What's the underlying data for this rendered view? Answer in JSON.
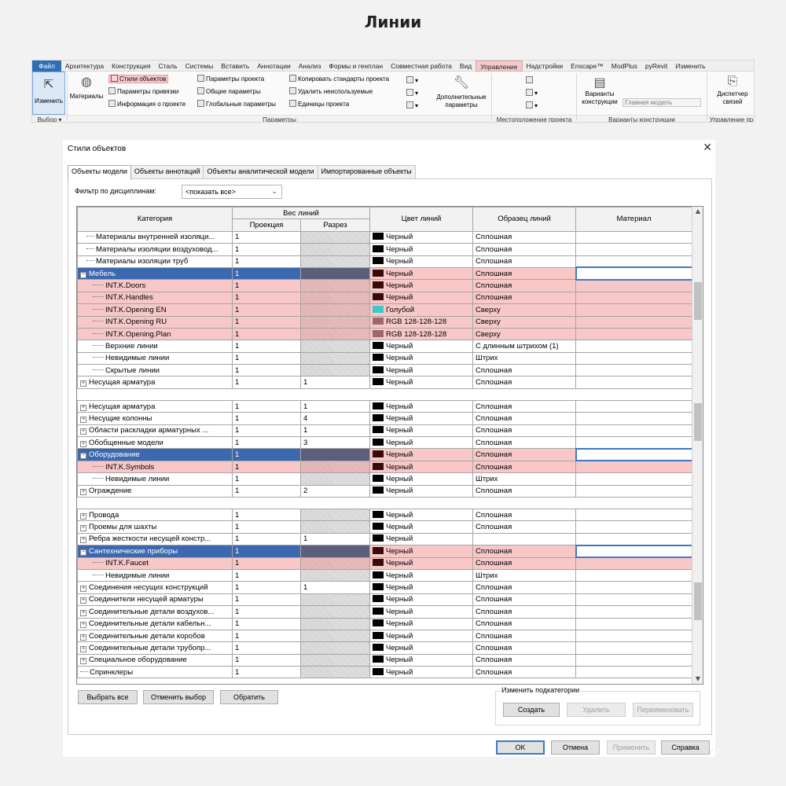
{
  "page": {
    "title": "Линии"
  },
  "ribbon": {
    "tabs": [
      "Файл",
      "Архитектура",
      "Конструкция",
      "Сталь",
      "Системы",
      "Вставить",
      "Аннотации",
      "Анализ",
      "Формы и генплан",
      "Совместная работа",
      "Вид",
      "Управление",
      "Надстройки",
      "Enscape™",
      "ModPlus",
      "pyRevit",
      "Изменить"
    ],
    "active_tab": "Управление",
    "modify_label": "Изменить",
    "materials_label": "Материалы",
    "object_styles": "Стили объектов",
    "snaps": "Параметры привязки",
    "project_info": "Информация о проекте",
    "project_params": "Параметры проекта",
    "shared_params": "Общие параметры",
    "global_params": "Глобальные параметры",
    "transfer_standards": "Копировать стандарты проекта",
    "purge_unused": "Удалить неиспользуемые",
    "project_units": "Единицы проекта",
    "additional_settings": "Дополнительные параметры",
    "design_options": "Варианты конструкции",
    "main_model": "Главная модель",
    "manage_links": "Диспетчер связей",
    "panels": {
      "select": "Выбор ▾",
      "settings": "Параметры",
      "location": "Местоположение проекта",
      "design_options": "Варианты конструкции",
      "manage_project": "Управление пр"
    }
  },
  "dialog": {
    "title": "Стили объектов",
    "tabs": [
      "Объекты модели",
      "Объекты аннотаций",
      "Объекты аналитической модели",
      "Импортированные объекты"
    ],
    "filter_label": "Фильтр по дисциплинам:",
    "filter_value": "<показать все>",
    "columns": {
      "category": "Категория",
      "line_weight": "Вес линий",
      "projection": "Проекция",
      "cut": "Разрез",
      "line_color": "Цвет линий",
      "line_pattern": "Образец линий",
      "material": "Материал"
    },
    "rows_block1": [
      {
        "name": "Материалы внутренней изоляци...",
        "indent": 1,
        "exp": "",
        "proj": "1",
        "cut": "",
        "color": "Черный",
        "swatch": "#000000",
        "pattern": "Сплошная",
        "hl": false,
        "sel": false
      },
      {
        "name": "Материалы изоляции воздуховод...",
        "indent": 1,
        "exp": "",
        "proj": "1",
        "cut": "",
        "color": "Черный",
        "swatch": "#000000",
        "pattern": "Сплошная",
        "hl": false,
        "sel": false
      },
      {
        "name": "Материалы изоляции труб",
        "indent": 1,
        "exp": "",
        "proj": "1",
        "cut": "",
        "color": "Черный",
        "swatch": "#000000",
        "pattern": "Сплошная",
        "hl": false,
        "sel": false
      },
      {
        "name": "Мебель",
        "indent": 0,
        "exp": "−",
        "proj": "1",
        "cut": "",
        "color": "Черный",
        "swatch": "#3a0a0a",
        "pattern": "Сплошная",
        "hl": true,
        "sel": true
      },
      {
        "name": "INT.K.Doors",
        "indent": 2,
        "exp": "",
        "proj": "1",
        "cut": "",
        "color": "Черный",
        "swatch": "#3a0a0a",
        "pattern": "Сплошная",
        "hl": true,
        "sel": false
      },
      {
        "name": "INT.K.Handles",
        "indent": 2,
        "exp": "",
        "proj": "1",
        "cut": "",
        "color": "Черный",
        "swatch": "#3a0a0a",
        "pattern": "Сплошная",
        "hl": true,
        "sel": false
      },
      {
        "name": "INT.K.Opening EN",
        "indent": 2,
        "exp": "",
        "proj": "1",
        "cut": "",
        "color": "Голубой",
        "swatch": "#3fc6c6",
        "pattern": "Сверху",
        "hl": true,
        "sel": false
      },
      {
        "name": "INT.K.Opening RU",
        "indent": 2,
        "exp": "",
        "proj": "1",
        "cut": "",
        "color": "RGB 128-128-128",
        "swatch": "#a06868",
        "pattern": "Сверху",
        "hl": true,
        "sel": false
      },
      {
        "name": "INT.K.Opening.Plan",
        "indent": 2,
        "exp": "",
        "proj": "1",
        "cut": "",
        "color": "RGB 128-128-128",
        "swatch": "#a06868",
        "pattern": "Сверху",
        "hl": true,
        "sel": false
      },
      {
        "name": "Верхние линии",
        "indent": 2,
        "exp": "",
        "proj": "1",
        "cut": "",
        "color": "Черный",
        "swatch": "#000000",
        "pattern": "С длинным штрихом (1)",
        "hl": false,
        "sel": false
      },
      {
        "name": "Невидимые линии",
        "indent": 2,
        "exp": "",
        "proj": "1",
        "cut": "",
        "color": "Черный",
        "swatch": "#000000",
        "pattern": "Штрих",
        "hl": false,
        "sel": false
      },
      {
        "name": "Скрытые линии",
        "indent": 2,
        "exp": "",
        "proj": "1",
        "cut": "",
        "color": "Черный",
        "swatch": "#000000",
        "pattern": "Сплошная",
        "hl": false,
        "sel": false
      },
      {
        "name": "Несущая арматура",
        "indent": 0,
        "exp": "+",
        "proj": "1",
        "cut": "1",
        "color": "Черный",
        "swatch": "#000000",
        "pattern": "Сплошная",
        "hl": false,
        "sel": false
      }
    ],
    "rows_block2": [
      {
        "name": "Несущая арматура",
        "indent": 0,
        "exp": "+",
        "proj": "1",
        "cut": "1",
        "color": "Черный",
        "swatch": "#000000",
        "pattern": "Сплошная",
        "hl": false,
        "sel": false
      },
      {
        "name": "Несущие колонны",
        "indent": 0,
        "exp": "+",
        "proj": "1",
        "cut": "4",
        "color": "Черный",
        "swatch": "#000000",
        "pattern": "Сплошная",
        "hl": false,
        "sel": false
      },
      {
        "name": "Области раскладки арматурных ...",
        "indent": 0,
        "exp": "+",
        "proj": "1",
        "cut": "1",
        "color": "Черный",
        "swatch": "#000000",
        "pattern": "Сплошная",
        "hl": false,
        "sel": false
      },
      {
        "name": "Обобщенные модели",
        "indent": 0,
        "exp": "+",
        "proj": "1",
        "cut": "3",
        "color": "Черный",
        "swatch": "#000000",
        "pattern": "Сплошная",
        "hl": false,
        "sel": false
      },
      {
        "name": "Оборудование",
        "indent": 0,
        "exp": "−",
        "proj": "1",
        "cut": "",
        "color": "Черный",
        "swatch": "#3a0a0a",
        "pattern": "Сплошная",
        "hl": true,
        "sel": true
      },
      {
        "name": "INT.K.Symbols",
        "indent": 2,
        "exp": "",
        "proj": "1",
        "cut": "",
        "color": "Черный",
        "swatch": "#3a0a0a",
        "pattern": "Сплошная",
        "hl": true,
        "sel": false
      },
      {
        "name": "Невидимые линии",
        "indent": 2,
        "exp": "",
        "proj": "1",
        "cut": "",
        "color": "Черный",
        "swatch": "#000000",
        "pattern": "Штрих",
        "hl": false,
        "sel": false
      },
      {
        "name": "Ограждение",
        "indent": 0,
        "exp": "+",
        "proj": "1",
        "cut": "2",
        "color": "Черный",
        "swatch": "#000000",
        "pattern": "Сплошная",
        "hl": false,
        "sel": false
      }
    ],
    "rows_block3": [
      {
        "name": "Провода",
        "indent": 0,
        "exp": "+",
        "proj": "1",
        "cut": "",
        "color": "Черный",
        "swatch": "#000000",
        "pattern": "Сплошная",
        "hl": false,
        "sel": false
      },
      {
        "name": "Проемы для шахты",
        "indent": 0,
        "exp": "+",
        "proj": "1",
        "cut": "",
        "color": "Черный",
        "swatch": "#000000",
        "pattern": "Сплошная",
        "hl": false,
        "sel": false
      },
      {
        "name": "Ребра жесткости несущей констр...",
        "indent": 0,
        "exp": "+",
        "proj": "1",
        "cut": "1",
        "color": "Черный",
        "swatch": "#000000",
        "pattern": "",
        "hl": false,
        "sel": false
      },
      {
        "name": "Сантехнические приборы",
        "indent": 0,
        "exp": "−",
        "proj": "1",
        "cut": "",
        "color": "Черный",
        "swatch": "#3a0a0a",
        "pattern": "Сплошная",
        "hl": true,
        "sel": true
      },
      {
        "name": "INT.K.Faucet",
        "indent": 2,
        "exp": "",
        "proj": "1",
        "cut": "",
        "color": "Черный",
        "swatch": "#3a0a0a",
        "pattern": "Сплошная",
        "hl": true,
        "sel": false
      },
      {
        "name": "Невидимые линии",
        "indent": 2,
        "exp": "",
        "proj": "1",
        "cut": "",
        "color": "Черный",
        "swatch": "#000000",
        "pattern": "Штрих",
        "hl": false,
        "sel": false
      },
      {
        "name": "Соединения несущих конструкций",
        "indent": 0,
        "exp": "+",
        "proj": "1",
        "cut": "1",
        "color": "Черный",
        "swatch": "#000000",
        "pattern": "Сплошная",
        "hl": false,
        "sel": false
      },
      {
        "name": "Соединители несущей арматуры",
        "indent": 0,
        "exp": "+",
        "proj": "1",
        "cut": "",
        "color": "Черный",
        "swatch": "#000000",
        "pattern": "Сплошная",
        "hl": false,
        "sel": false
      },
      {
        "name": "Соединительные детали воздухов...",
        "indent": 0,
        "exp": "+",
        "proj": "1",
        "cut": "",
        "color": "Черный",
        "swatch": "#000000",
        "pattern": "Сплошная",
        "hl": false,
        "sel": false
      },
      {
        "name": "Соединительные детали кабельн...",
        "indent": 0,
        "exp": "+",
        "proj": "1",
        "cut": "",
        "color": "Черный",
        "swatch": "#000000",
        "pattern": "Сплошная",
        "hl": false,
        "sel": false
      },
      {
        "name": "Соединительные детали коробов",
        "indent": 0,
        "exp": "+",
        "proj": "1",
        "cut": "",
        "color": "Черный",
        "swatch": "#000000",
        "pattern": "Сплошная",
        "hl": false,
        "sel": false
      },
      {
        "name": "Соединительные детали трубопр...",
        "indent": 0,
        "exp": "+",
        "proj": "1",
        "cut": "",
        "color": "Черный",
        "swatch": "#000000",
        "pattern": "Сплошная",
        "hl": false,
        "sel": false
      },
      {
        "name": "Специальное оборудование",
        "indent": 0,
        "exp": "+",
        "proj": "1",
        "cut": "",
        "color": "Черный",
        "swatch": "#000000",
        "pattern": "Сплошная",
        "hl": false,
        "sel": false
      },
      {
        "name": "Спринклеры",
        "indent": 0,
        "exp": "",
        "proj": "1",
        "cut": "",
        "color": "Черный",
        "swatch": "#000000",
        "pattern": "Сплошная",
        "hl": false,
        "sel": false
      }
    ],
    "buttons": {
      "select_all": "Выбрать все",
      "deselect": "Отменить выбор",
      "invert": "Обратить",
      "subcat_group": "Изменить подкатегории",
      "create": "Создать",
      "delete": "Удалить",
      "rename": "Переименовать",
      "ok": "OK",
      "cancel": "Отмена",
      "apply": "Применить",
      "help": "Справка"
    }
  },
  "colors": {
    "highlight": "#f8c8c8",
    "selection": "#3c68b0",
    "accent": "#2f6db5"
  }
}
